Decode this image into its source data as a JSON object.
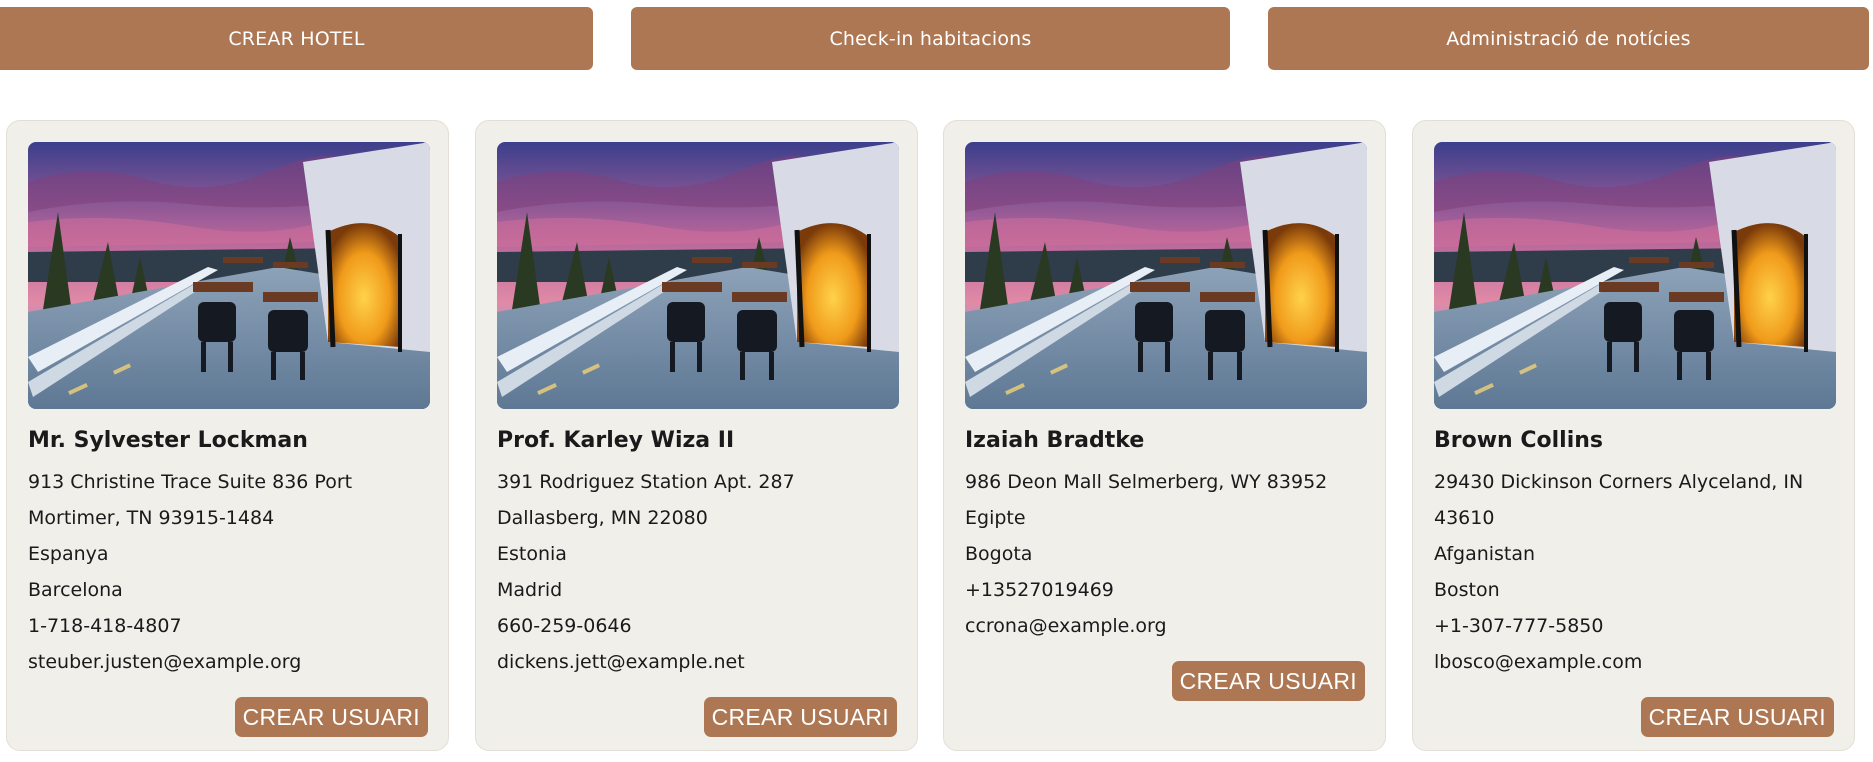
{
  "nav": {
    "crear_hotel": "CREAR HOTEL",
    "checkin": "Check-in habitacions",
    "noticies": "Administració de notícies"
  },
  "colors": {
    "accent": "#ae7753",
    "card_bg": "#f1efea"
  },
  "cards": [
    {
      "name": "Mr. Sylvester Lockman",
      "address_1": "913 Christine Trace Suite 836 Port",
      "address_2": "Mortimer, TN 93915-1484",
      "country": "Espanya",
      "city": "Barcelona",
      "phone": "1-718-418-4807",
      "email": "steuber.justen@example.org",
      "button": "CREAR USUARI"
    },
    {
      "name": "Prof. Karley Wiza II",
      "address_1": "391 Rodriguez Station Apt. 287",
      "address_2": "Dallasberg, MN 22080",
      "country": "Estonia",
      "city": "Madrid",
      "phone": "660-259-0646",
      "email": "dickens.jett@example.net",
      "button": "CREAR USUARI"
    },
    {
      "name": "Izaiah Bradtke",
      "address_1": "986 Deon Mall Selmerberg, WY 83952",
      "country": "Egipte",
      "city": "Bogota",
      "phone": "+13527019469",
      "email": "ccrona@example.org",
      "button": "CREAR USUARI"
    },
    {
      "name": "Brown Collins",
      "address_1": "29430 Dickinson Corners Alyceland, IN",
      "address_2": "43610",
      "country": "Afganistan",
      "city": "Boston",
      "phone": "+1-307-777-5850",
      "email": "lbosco@example.com",
      "button": "CREAR USUARI"
    }
  ]
}
